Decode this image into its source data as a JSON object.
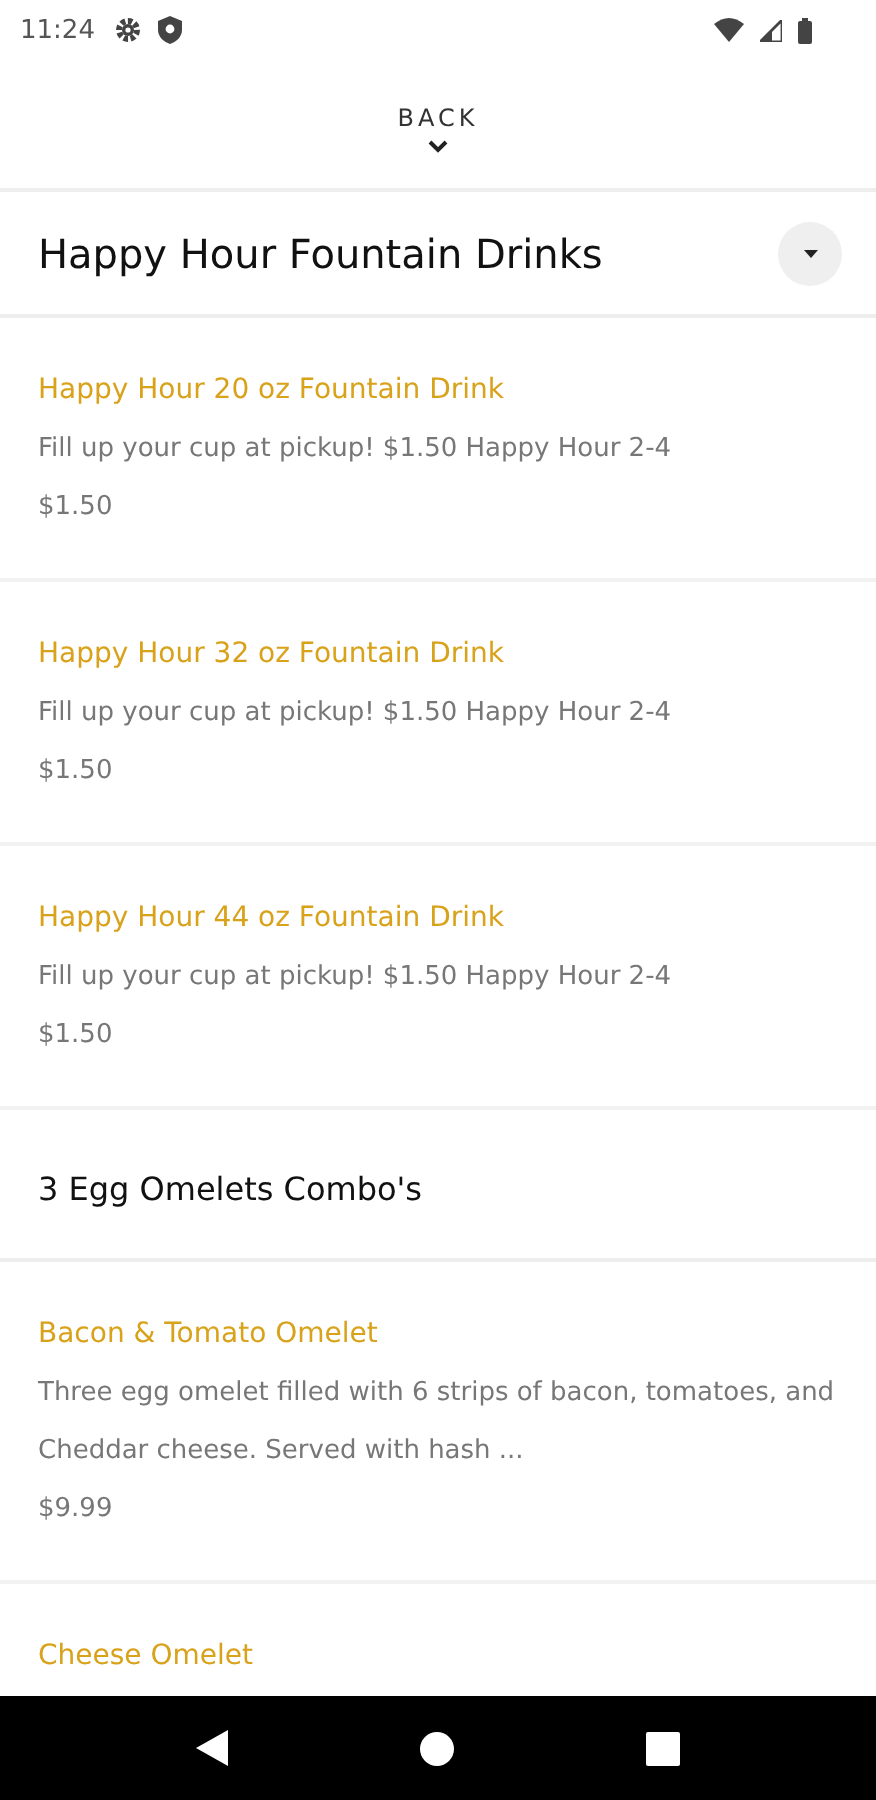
{
  "status_bar": {
    "time": "11:24"
  },
  "back": {
    "label": "BACK"
  },
  "sections": [
    {
      "title": "Happy Hour Fountain Drinks",
      "dropdown": true,
      "items": [
        {
          "name": "Happy Hour 20 oz Fountain Drink",
          "description": "Fill up your cup at pickup! $1.50 Happy Hour 2-4",
          "price": "$1.50"
        },
        {
          "name": "Happy Hour 32 oz Fountain Drink",
          "description": "Fill up your cup at pickup! $1.50 Happy Hour 2-4",
          "price": "$1.50"
        },
        {
          "name": "Happy Hour 44 oz Fountain Drink",
          "description": "Fill up your cup at pickup! $1.50 Happy Hour 2-4",
          "price": "$1.50"
        }
      ]
    },
    {
      "title": "3 Egg Omelets Combo's",
      "dropdown": false,
      "items": [
        {
          "name": "Bacon & Tomato Omelet",
          "description": "Three egg omelet filled with 6 strips of bacon, tomatoes, and Cheddar cheese. Served with hash ...",
          "price": "$9.99"
        },
        {
          "name": "Cheese Omelet"
        }
      ]
    }
  ]
}
